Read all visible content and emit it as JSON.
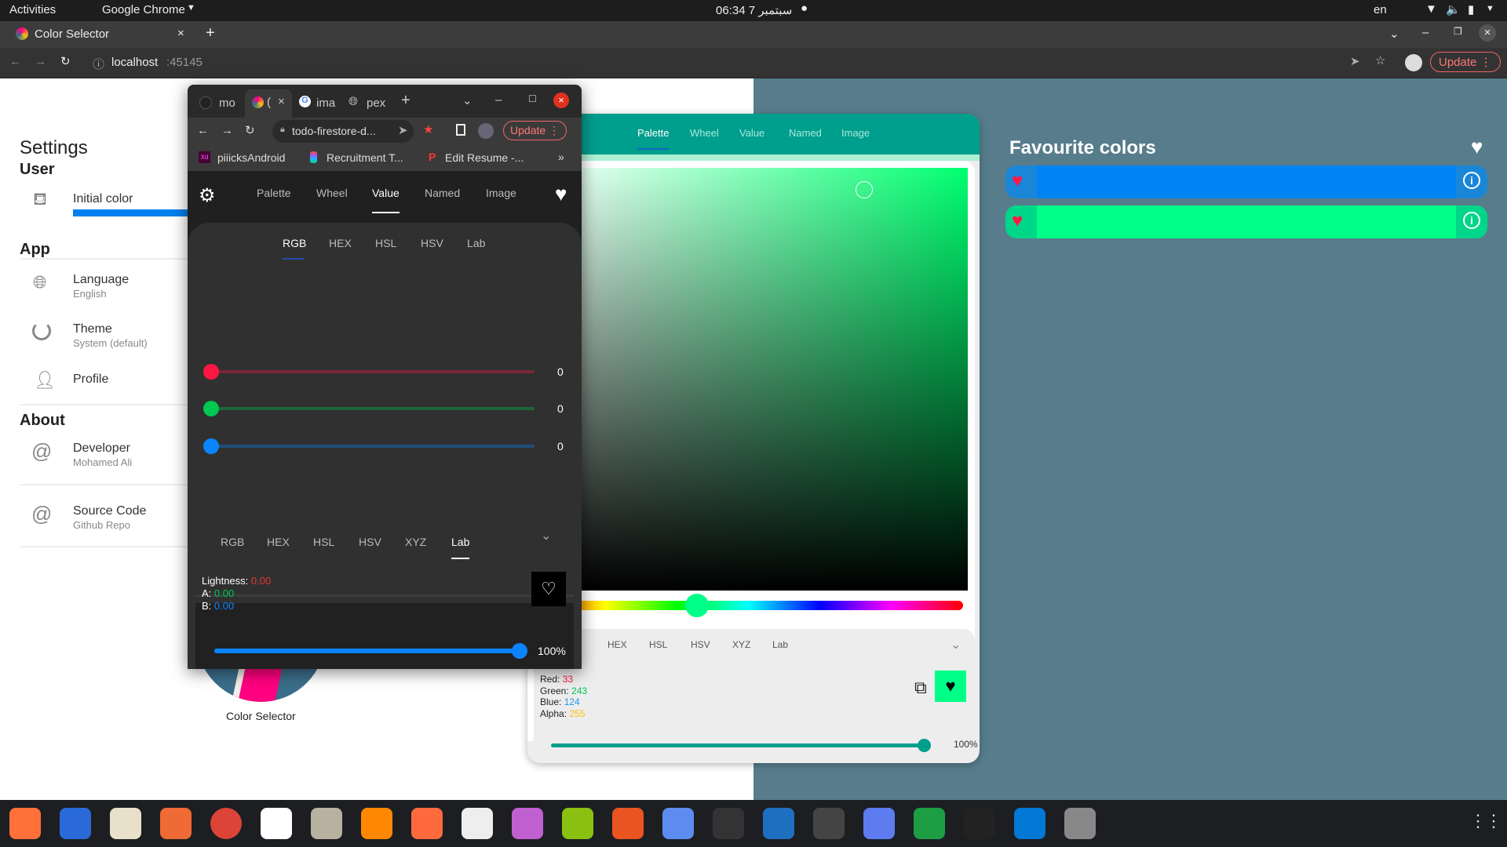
{
  "system": {
    "activities": "Activities",
    "app_menu": "Google Chrome",
    "clock": "06:34  7 سبتمبر",
    "lang": "en"
  },
  "browser": {
    "tab_title": "Color Selector",
    "url_host": "localhost",
    "url_port": ":45145",
    "update": "Update"
  },
  "settings": {
    "title": "Settings",
    "user": "User",
    "initial_color": "Initial color",
    "app": "App",
    "language": "Language",
    "language_val": "English",
    "theme": "Theme",
    "theme_val": "System (default)",
    "profile": "Profile",
    "about": "About",
    "developer": "Developer",
    "developer_val": "Mohamed Ali",
    "source": "Source Code",
    "source_val": "Github Repo",
    "logo_label": "Color Selector",
    "initial_color_hex": "#0080ee"
  },
  "popup": {
    "tabs": [
      "mo",
      "(",
      "ima",
      "pex"
    ],
    "url": "todo-firestore-d...",
    "update": "Update",
    "bookmarks": [
      "piiicksAndroid",
      "Recruitment T...",
      "Edit Resume -..."
    ],
    "nav": [
      "Palette",
      "Wheel",
      "Value",
      "Named",
      "Image"
    ],
    "nav_active": "Value",
    "subtabs": [
      "RGB",
      "HEX",
      "HSL",
      "HSV",
      "Lab"
    ],
    "subtab_active": "RGB",
    "sliders": [
      {
        "color": "#ff1744",
        "value": "0"
      },
      {
        "color": "#00c853",
        "value": "0"
      },
      {
        "color": "#0a84ff",
        "value": "0"
      }
    ],
    "out_tabs": [
      "RGB",
      "HEX",
      "HSL",
      "HSV",
      "XYZ",
      "Lab"
    ],
    "out_active": "Lab",
    "lab": {
      "l_label": "Lightness: ",
      "l": "0.00",
      "a_label": "A: ",
      "a": "0.00",
      "b_label": "B: ",
      "b": "0.00"
    },
    "alpha": "100%",
    "alpha_fraction": 1.0
  },
  "palette_app": {
    "nav": [
      "Palette",
      "Wheel",
      "Value",
      "Named",
      "Image"
    ],
    "nav_active": "Palette",
    "hue_fraction": 0.38,
    "out_tabs": [
      "HEX",
      "HSL",
      "HSV",
      "XYZ",
      "Lab"
    ],
    "rgb": {
      "red_label": "Red: ",
      "red": "33",
      "green_label": "Green: ",
      "green": "243",
      "blue_label": "Blue: ",
      "blue": "124",
      "alpha_label": "Alpha: ",
      "alpha": "255"
    },
    "selected_color": "#00ff88",
    "opacity": "100%",
    "opacity_fraction": 1.0,
    "accent": "#009e8c"
  },
  "favourites": {
    "title": "Favourite colors",
    "items": [
      {
        "color": "#0084f4",
        "edge": "#1a86d8"
      },
      {
        "color": "#00ff88",
        "edge": "#00d68a"
      }
    ]
  }
}
